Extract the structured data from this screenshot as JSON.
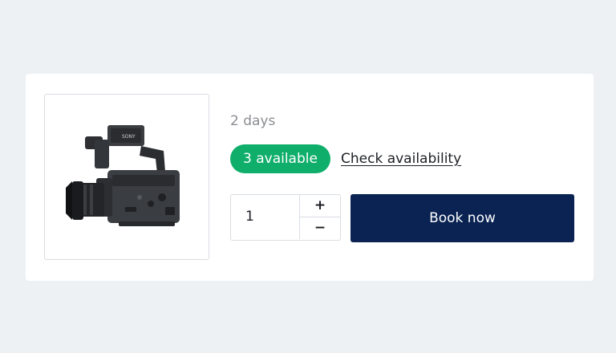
{
  "product": {
    "image_icon": "video-camera-icon",
    "camera_brand": "SONY",
    "duration": "2 days",
    "availability_badge": "3 available",
    "check_availability_link": "Check availability",
    "quantity": "1",
    "increment_label": "+",
    "decrement_label": "−",
    "book_button": "Book now"
  },
  "colors": {
    "page_background": "#eef1f4",
    "card_background": "#ffffff",
    "badge_green": "#0fae6b",
    "book_button_navy": "#0a2353",
    "muted_text": "#8a8d91"
  }
}
